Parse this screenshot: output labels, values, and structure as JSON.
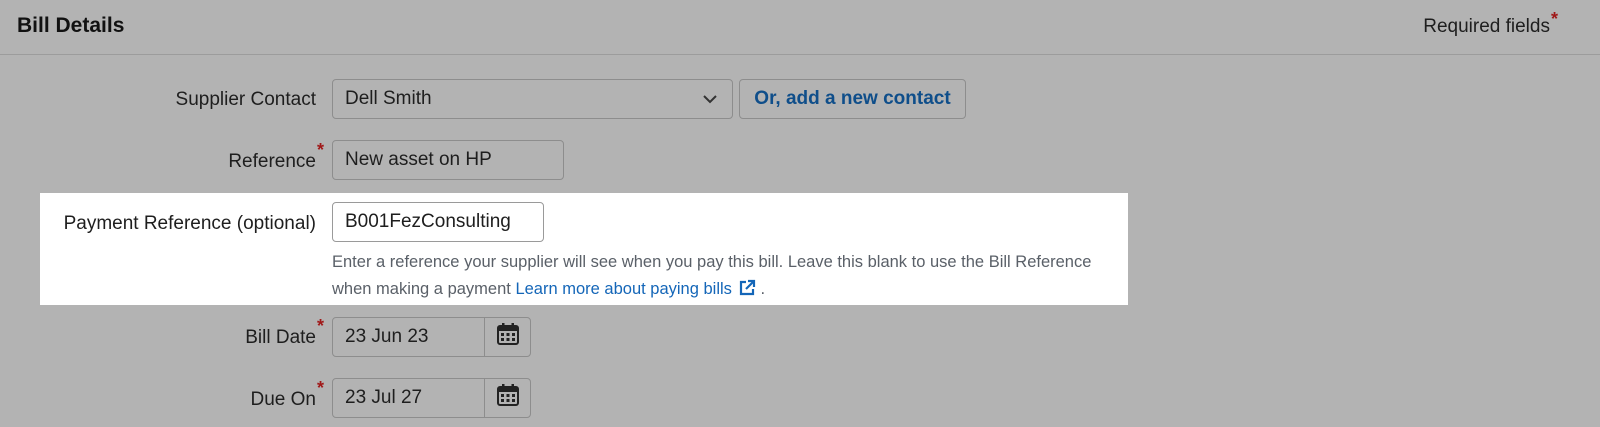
{
  "header": {
    "title": "Bill Details",
    "required_note": "Required fields",
    "required_star": "*"
  },
  "form": {
    "supplier_contact": {
      "label": "Supplier Contact",
      "value": "Dell Smith",
      "add_contact_label": "Or, add a new contact"
    },
    "reference": {
      "label": "Reference",
      "value": "New asset on HP",
      "star": "*"
    },
    "payment_reference": {
      "label": "Payment Reference (optional)",
      "value": "B001FezConsulting",
      "help_text": "Enter a reference your supplier will see when you pay this bill. Leave this blank to use the Bill Reference when making a payment",
      "help_link": "Learn more about paying bills",
      "help_end": "."
    },
    "bill_date": {
      "label": "Bill Date",
      "value": "23 Jun 23",
      "star": "*"
    },
    "due_on": {
      "label": "Due On",
      "value": "23 Jul 27",
      "star": "*"
    }
  },
  "icons": {
    "dropdown": "chevron-down-icon",
    "calendar": "calendar-icon",
    "external_link": "external-link-icon"
  },
  "colors": {
    "page_bg": "#b3b3b3",
    "link": "#1466b8",
    "required_star": "#a01818",
    "highlight_bg": "#ffffff"
  }
}
